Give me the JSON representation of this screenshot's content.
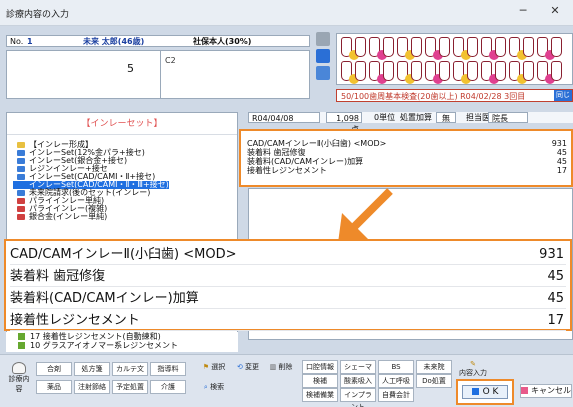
{
  "window": {
    "title": "診療内容の入力",
    "minimize": "─",
    "close": "✕"
  },
  "patient": {
    "no_label": "No.",
    "no_value": "1",
    "name": "未来 太郎(46歳)",
    "insurance": "社保本人(30%)"
  },
  "tooth_input": {
    "value": "5",
    "note": "C2"
  },
  "exam_bar": {
    "text": "50/100歯周基本検査(20歯以上) R04/02/28 3回目",
    "button": "同じ"
  },
  "left_panel": {
    "header": "【インレーセット】",
    "tree": [
      {
        "label": "【インレー形成】",
        "color": "#e8c040",
        "selected": false
      },
      {
        "label": "インレーSet(12%金パラ+接セ)",
        "color": "#3a7cd8",
        "selected": false
      },
      {
        "label": "インレーSet(銀合金+接セ)",
        "color": "#3a7cd8",
        "selected": false
      },
      {
        "label": "レジンインレー+接セ",
        "color": "#3a7cd8",
        "selected": false
      },
      {
        "label": "インレーSet(CAD/CAMⅠ・Ⅱ+接セ)",
        "color": "#3a7cd8",
        "selected": false
      },
      {
        "label": "インレーSet(CAD/CAMⅠ・Ⅱ・Ⅲ+接セ)",
        "color": "#1f6fe0",
        "selected": true
      },
      {
        "label": "未来院請求(後のセット(インレー)",
        "color": "#3a7cd8",
        "selected": false
      },
      {
        "label": "パライインレー単純)",
        "color": "#d04040",
        "selected": false
      },
      {
        "label": "パライインレー(複雑)",
        "color": "#d04040",
        "selected": false
      },
      {
        "label": "銀合金(インレー単純)",
        "color": "#d04040",
        "selected": false
      }
    ],
    "below": [
      {
        "label": "17 接着性レジンセメント(自動練和)"
      },
      {
        "label": "10 グラスアイオノマー系レジンセメント"
      }
    ]
  },
  "info_bar": {
    "date": "R04/04/08",
    "points": "1,098 点",
    "units": "0単位",
    "treatment_label": "処置加算",
    "treatment_value": "無",
    "doctor_label": "担当医",
    "doctor_value": "院長"
  },
  "items": [
    {
      "label": "CAD/CAMインレーⅡ(小臼歯) <MOD>",
      "value": "931"
    },
    {
      "label": "装着料 歯冠修復",
      "value": "45"
    },
    {
      "label": "装着料(CAD/CAMインレー)加算",
      "value": "45"
    },
    {
      "label": "接着性レジンセメント",
      "value": "17"
    }
  ],
  "toolbar": {
    "icon_left": "診療内容",
    "row1": [
      "合剤",
      "処方箋",
      "カルテ文",
      "指導料"
    ],
    "row2": [
      "薬品",
      "注射節絡",
      "予定処置",
      "介護"
    ],
    "select": "選択",
    "change": "変更",
    "delete": "削除",
    "search": "検索",
    "center_row1": [
      "口腔情報",
      "シェーマ",
      "BS",
      "未来院"
    ],
    "center_row2": [
      "検補",
      "酸素吸入",
      "人工呼吸",
      "Do処置"
    ],
    "center_row3": [
      "検補備業",
      "インプラント",
      "自費会計"
    ],
    "input_label": "内容入力",
    "ok": "O K",
    "cancel": "キャンセル"
  },
  "colors": {
    "highlight": "#ee8a2a",
    "selection": "#1f6fe0",
    "header_red": "#e05050"
  }
}
